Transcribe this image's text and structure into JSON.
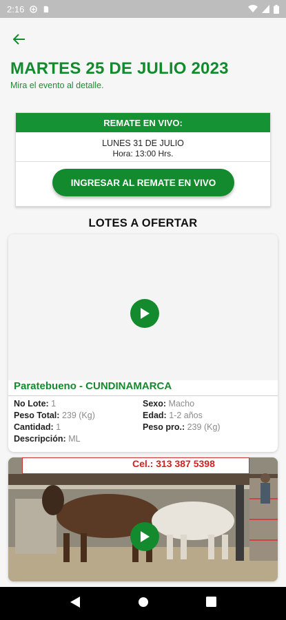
{
  "status_bar": {
    "time": "2:16"
  },
  "header": {
    "title": "MARTES 25 DE JULIO 2023",
    "subtitle": "Mira el evento al detalle."
  },
  "live_auction": {
    "header": "REMATE EN VIVO:",
    "date": "LUNES 31 DE JULIO",
    "hour": "Hora: 13:00 Hrs.",
    "button_label": "INGRESAR AL REMATE EN VIVO"
  },
  "lots_section": {
    "title": "LOTES A OFERTAR"
  },
  "lots": [
    {
      "location": "Paratebueno - CUNDINAMARCA",
      "lot_no_label": "No Lote:",
      "lot_no": "1",
      "total_weight_label": "Peso Total:",
      "total_weight": "239 (Kg)",
      "quantity_label": "Cantidad:",
      "quantity": "1",
      "description_label": "Descripción:",
      "description": "ML",
      "sex_label": "Sexo:",
      "sex": "Macho",
      "age_label": "Edad:",
      "age": "1-2 años",
      "avg_weight_label": "Peso pro.:",
      "avg_weight": "239 (Kg)"
    },
    {
      "banner_text": "Cel.: 313 387 5398"
    }
  ],
  "colors": {
    "accent": "#138a2d",
    "live_header": "#159233"
  }
}
